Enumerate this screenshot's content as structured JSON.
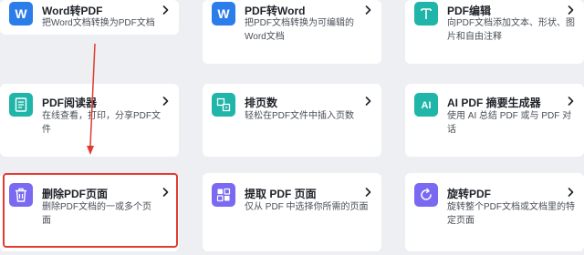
{
  "colors": {
    "background": "#eeeff3",
    "card": "#ffffff",
    "highlight": "#e03c31",
    "icon_word": "#2b7de9",
    "icon_edit": "#1fb5a8",
    "icon_read": "#1fb5a8",
    "icon_page_number": "#1fb5a8",
    "icon_ai": "#1fb5a8",
    "icon_delete": "#7a6af2",
    "icon_extract": "#7a6af2",
    "icon_rotate": "#7a6af2"
  },
  "tools": [
    {
      "title": "Word转PDF",
      "desc": "把Word文档转换为PDF文档",
      "icon": "word-icon"
    },
    {
      "title": "PDF转Word",
      "desc": "把PDF文档转换为可编辑的Word文档",
      "icon": "word-icon"
    },
    {
      "title": "PDF编辑",
      "desc": "向PDF文档添加文本、形状、图片和自由注释",
      "icon": "text-icon"
    },
    {
      "title": "PDF阅读器",
      "desc": "在线查看，打印，分享PDF文件",
      "icon": "document-icon"
    },
    {
      "title": "排页数",
      "desc": "轻松在PDF文件中插入页数",
      "icon": "page-number-icon"
    },
    {
      "title": "AI PDF 摘要生成器",
      "desc": "使用 AI 总结 PDF 或与 PDF 对话",
      "icon": "ai-icon"
    },
    {
      "title": "删除PDF页面",
      "desc": "删除PDF文档的一或多个页面",
      "icon": "trash-icon"
    },
    {
      "title": "提取 PDF 页面",
      "desc": "仅从 PDF 中选择你所需的页面",
      "icon": "extract-pages-icon"
    },
    {
      "title": "旋转PDF",
      "desc": "旋转整个PDF文档或文档里的特定页面",
      "icon": "rotate-icon"
    }
  ]
}
